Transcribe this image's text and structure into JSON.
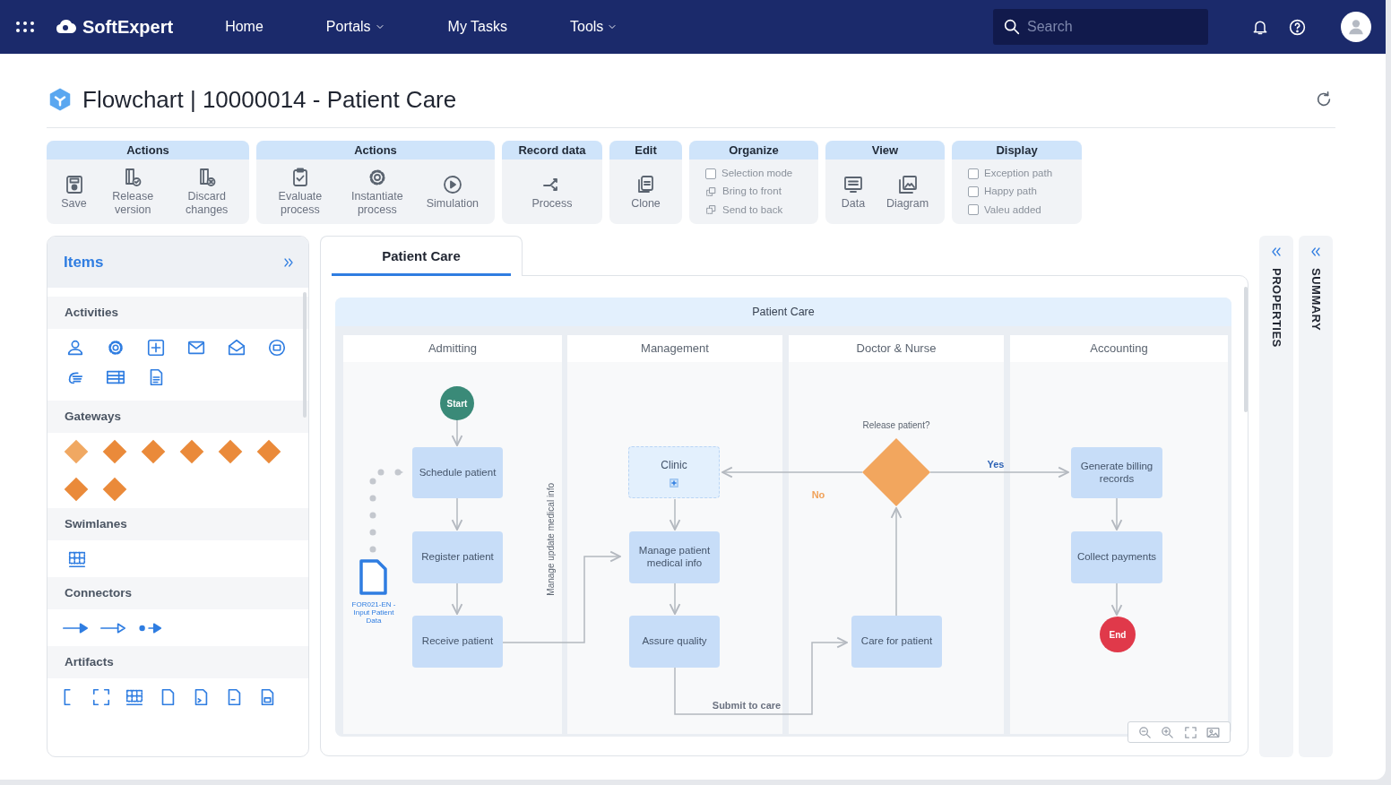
{
  "navbar": {
    "brand": "SoftExpert",
    "links": [
      {
        "label": "Home",
        "dropdown": false
      },
      {
        "label": "Portals",
        "dropdown": true
      },
      {
        "label": "My Tasks",
        "dropdown": false
      },
      {
        "label": "Tools",
        "dropdown": true
      }
    ],
    "search": {
      "placeholder": "Search"
    }
  },
  "page": {
    "title": "Flowchart | 10000014 - Patient Care"
  },
  "toolbar": [
    {
      "title": "Actions",
      "items": [
        {
          "kind": "button",
          "label": "Save"
        },
        {
          "kind": "button",
          "label": "Release version"
        },
        {
          "kind": "button",
          "label": "Discard changes"
        }
      ]
    },
    {
      "title": "Actions",
      "items": [
        {
          "kind": "button",
          "label": "Evaluate process"
        },
        {
          "kind": "button",
          "label": "Instantiate process"
        },
        {
          "kind": "button",
          "label": "Simulation"
        }
      ]
    },
    {
      "title": "Record data",
      "items": [
        {
          "kind": "button",
          "label": "Process"
        }
      ]
    },
    {
      "title": "Edit",
      "items": [
        {
          "kind": "button",
          "label": "Clone"
        }
      ]
    },
    {
      "title": "Organize",
      "items": [
        {
          "kind": "checkbox",
          "label": "Selection mode",
          "checked": false
        },
        {
          "kind": "command",
          "label": "Bring to front"
        },
        {
          "kind": "command",
          "label": "Send to back"
        }
      ]
    },
    {
      "title": "View",
      "items": [
        {
          "kind": "button",
          "label": "Data"
        },
        {
          "kind": "button",
          "label": "Diagram"
        }
      ]
    },
    {
      "title": "Display",
      "items": [
        {
          "kind": "checkbox",
          "label": "Exception path",
          "checked": false
        },
        {
          "kind": "checkbox",
          "label": "Happy path",
          "checked": false
        },
        {
          "kind": "checkbox",
          "label": "Valeu added",
          "checked": false
        }
      ]
    }
  ],
  "items_panel": {
    "title": "Items",
    "sections": [
      {
        "title": "Activities"
      },
      {
        "title": "Gateways"
      },
      {
        "title": "Swimlanes"
      },
      {
        "title": "Connectors"
      },
      {
        "title": "Artifacts"
      }
    ]
  },
  "diagram": {
    "tab": {
      "label": "Patient Care",
      "selected": true
    },
    "pool": "Patient Care",
    "lanes": [
      "Admitting",
      "Management",
      "Doctor & Nurse",
      "Accounting"
    ],
    "nodes": [
      {
        "kind": "start",
        "label": "Start"
      },
      {
        "kind": "task",
        "label": "Schedule patient"
      },
      {
        "kind": "task",
        "label": "Register patient"
      },
      {
        "kind": "task",
        "label": "Receive patient"
      },
      {
        "kind": "subprocess",
        "label": "Clinic"
      },
      {
        "kind": "task",
        "label": "Manage patient medical info"
      },
      {
        "kind": "task",
        "label": "Assure quality"
      },
      {
        "kind": "gateway",
        "label": "Release patient?"
      },
      {
        "kind": "task",
        "label": "Care for patient"
      },
      {
        "kind": "task",
        "label": "Generate billing records"
      },
      {
        "kind": "task",
        "label": "Collect payments"
      },
      {
        "kind": "end",
        "label": "End"
      }
    ],
    "document": {
      "label": "FOR021-EN - Input Patient Data"
    },
    "annotation": "Manage update medical info",
    "edge_labels": [
      {
        "label": "Yes",
        "color": "#2f64b6"
      },
      {
        "label": "No",
        "color": "#f0a25a"
      },
      {
        "label": "Submit to care",
        "color": "#6b7280"
      }
    ]
  },
  "side_panels": [
    {
      "label": "PROPERTIES"
    },
    {
      "label": "SUMMARY"
    }
  ]
}
